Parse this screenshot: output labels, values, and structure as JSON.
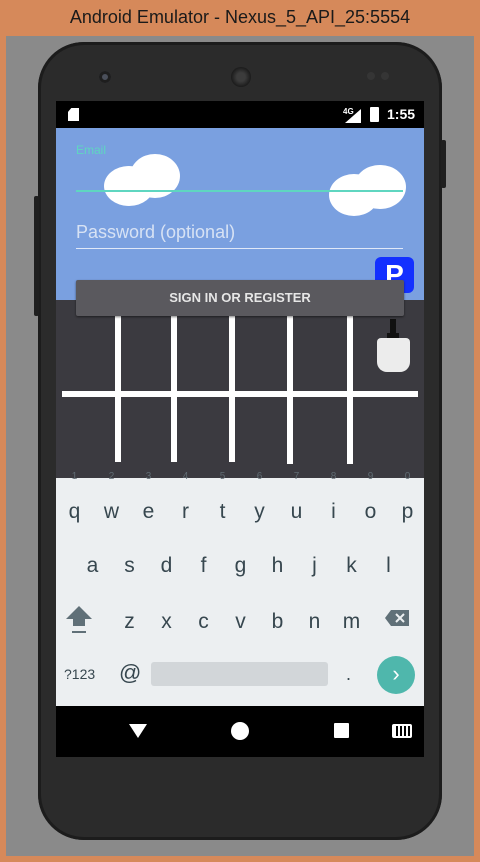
{
  "window": {
    "title": "Android Emulator - Nexus_5_API_25:5554"
  },
  "status_bar": {
    "network": "4G",
    "time": "1:55"
  },
  "form": {
    "email_label": "Email",
    "email_value": "",
    "password_placeholder": "Password (optional)",
    "parking_icon_label": "P",
    "signin_label": "SIGN IN OR REGISTER"
  },
  "keyboard": {
    "row1": [
      {
        "key": "q",
        "hint": "1"
      },
      {
        "key": "w",
        "hint": "2"
      },
      {
        "key": "e",
        "hint": "3"
      },
      {
        "key": "r",
        "hint": "4"
      },
      {
        "key": "t",
        "hint": "5"
      },
      {
        "key": "y",
        "hint": "6"
      },
      {
        "key": "u",
        "hint": "7"
      },
      {
        "key": "i",
        "hint": "8"
      },
      {
        "key": "o",
        "hint": "9"
      },
      {
        "key": "p",
        "hint": "0"
      }
    ],
    "row2": [
      "a",
      "s",
      "d",
      "f",
      "g",
      "h",
      "j",
      "k",
      "l"
    ],
    "row3": [
      "z",
      "x",
      "c",
      "v",
      "b",
      "n",
      "m"
    ],
    "symbols_label": "?123",
    "at_label": "@",
    "period_label": ".",
    "enter_label": "›"
  }
}
